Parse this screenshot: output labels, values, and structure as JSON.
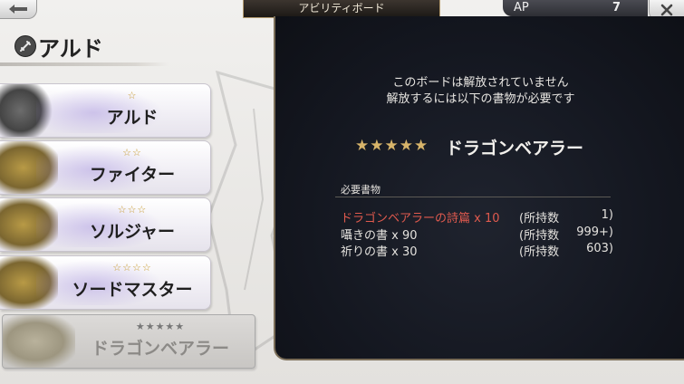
{
  "top_bar": {
    "title": "アビリティボード",
    "ap_label": "AP",
    "ap_value": "7",
    "back_icon": "back-arrow-icon",
    "close_icon": "close-icon"
  },
  "header": {
    "icon": "sword-emblem-icon",
    "name": "アルド"
  },
  "jobs": [
    {
      "stars": "☆",
      "label": "アルド",
      "state": "unlocked"
    },
    {
      "stars": "☆☆",
      "label": "ファイター",
      "state": "unlocked"
    },
    {
      "stars": "☆☆☆",
      "label": "ソルジャー",
      "state": "unlocked"
    },
    {
      "stars": "☆☆☆☆",
      "label": "ソードマスター",
      "state": "unlocked"
    },
    {
      "stars": "★★★★★",
      "label": "ドラゴンベアラー",
      "state": "locked"
    }
  ],
  "panel": {
    "notice_line1": "このボードは解放されていません",
    "notice_line2": "解放するには以下の書物が必要です",
    "book_stars": "★★★★★",
    "book_title": "ドラゴンベアラー",
    "requirements_header": "必要書物",
    "requirements": [
      {
        "name": "ドラゴンベアラーの詩篇 x 10",
        "owned_label": "(所持数",
        "owned": "1)",
        "insufficient": true
      },
      {
        "name": "囁きの書 x 90",
        "owned_label": "(所持数",
        "owned": "999+)",
        "insufficient": false
      },
      {
        "name": "祈りの書 x 30",
        "owned_label": "(所持数",
        "owned": "603)",
        "insufficient": false
      }
    ]
  },
  "colors": {
    "panel_bg": "#141720",
    "star_gold": "#c79a2e",
    "insufficient_red": "#e05a4e"
  }
}
